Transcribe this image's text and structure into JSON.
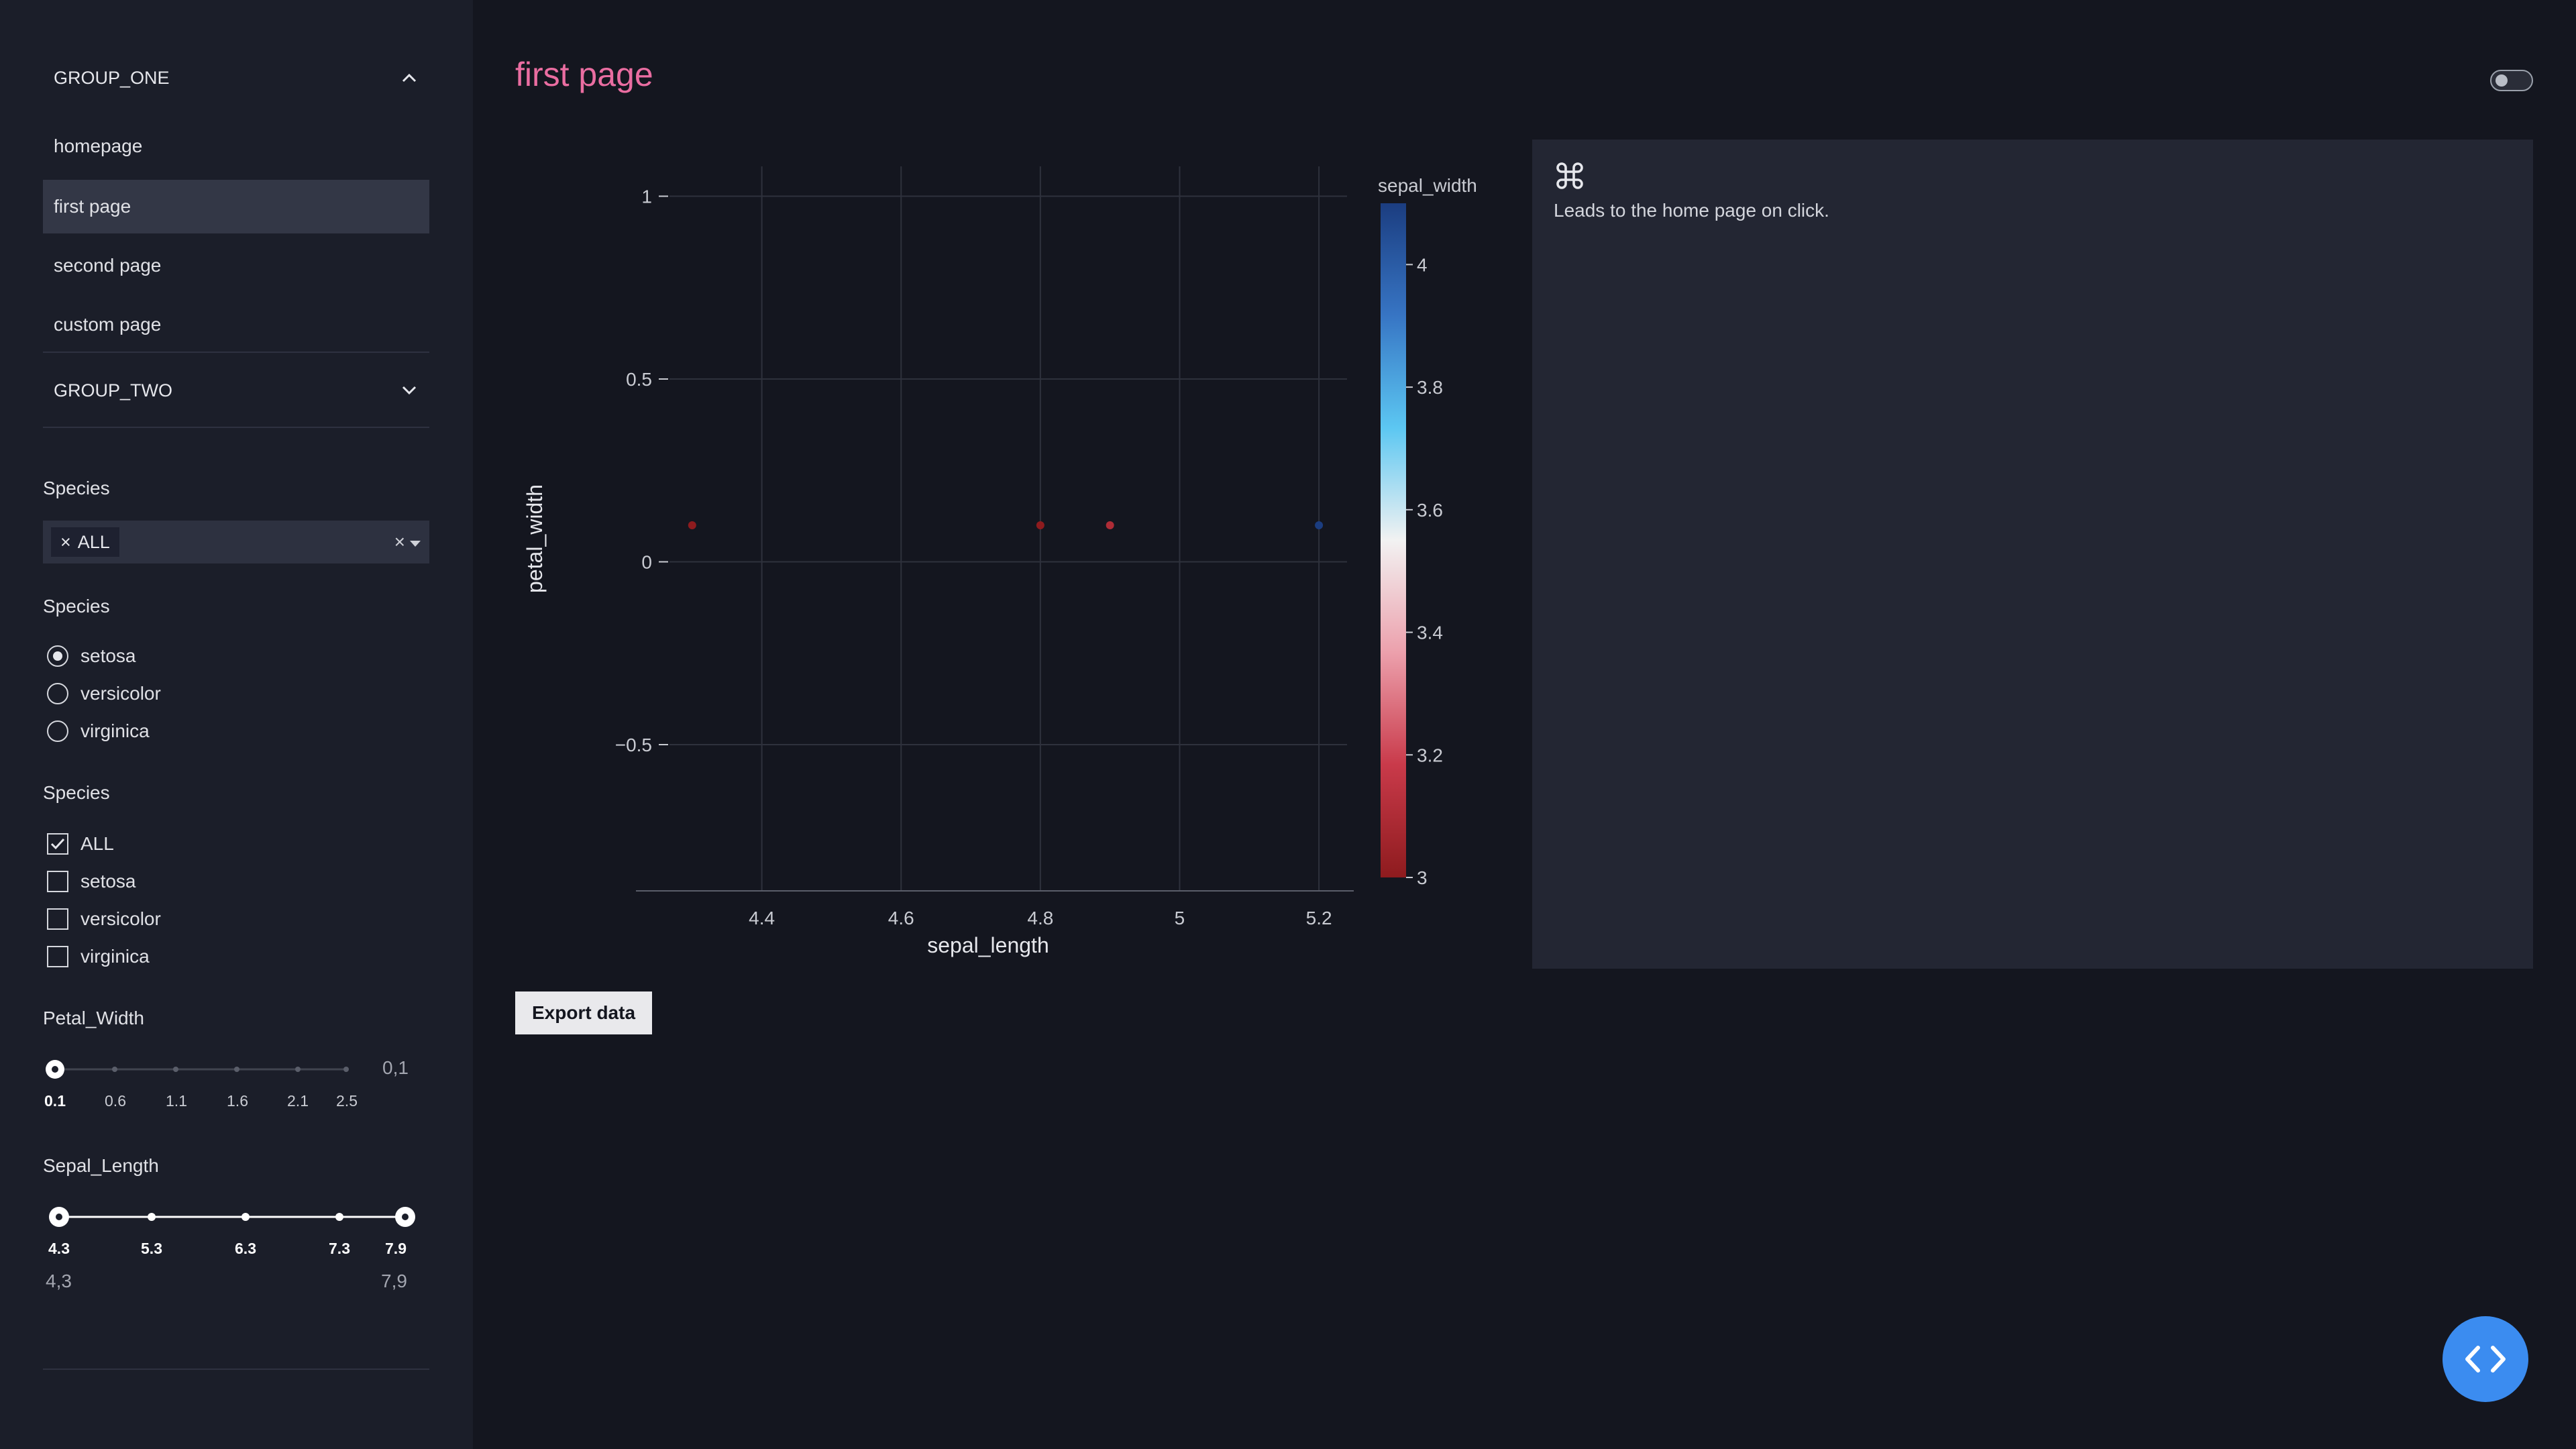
{
  "sidebar": {
    "group_one": {
      "label": "GROUP_ONE"
    },
    "nav_items": [
      {
        "label": "homepage"
      },
      {
        "label": "first page"
      },
      {
        "label": "second page"
      },
      {
        "label": "custom page"
      }
    ],
    "group_two": {
      "label": "GROUP_TWO"
    },
    "filters": {
      "dropdown": {
        "label": "Species",
        "selected": "ALL",
        "chip_remove": "×",
        "clear": "×"
      },
      "radio": {
        "label": "Species",
        "options": [
          "setosa",
          "versicolor",
          "virginica"
        ],
        "selected": "setosa"
      },
      "checklist": {
        "label": "Species",
        "options": [
          {
            "label": "ALL",
            "checked": true
          },
          {
            "label": "setosa",
            "checked": false
          },
          {
            "label": "versicolor",
            "checked": false
          },
          {
            "label": "virginica",
            "checked": false
          }
        ]
      },
      "petal_width": {
        "label": "Petal_Width",
        "marks": [
          "0.1",
          "0.6",
          "1.1",
          "1.6",
          "2.1",
          "2.5"
        ],
        "value_text": "0,1"
      },
      "sepal_length": {
        "label": "Sepal_Length",
        "marks": [
          "4.3",
          "5.3",
          "6.3",
          "7.3",
          "7.9"
        ],
        "min_text": "4,3",
        "max_text": "7,9"
      }
    }
  },
  "main": {
    "title": "first page",
    "export_label": "Export data",
    "card": {
      "text": "Leads to the home page on click."
    }
  },
  "colors": {
    "title": "#ea6da1",
    "accent": "#3b8cf0",
    "background": "#14161f",
    "sidebar": "#1b1e29",
    "card": "#232633"
  },
  "icons": {
    "theme": "toggle-switch-icon",
    "card": "command-icon",
    "fab": "code-brackets-icon"
  },
  "chart_data": {
    "type": "scatter",
    "title": "",
    "xlabel": "sepal_length",
    "ylabel": "petal_width",
    "xlim": [
      4.2,
      5.25
    ],
    "ylim": [
      -0.9,
      1.1
    ],
    "x_ticks": [
      4.4,
      4.6,
      4.8,
      5,
      5.2
    ],
    "x_tick_labels": [
      "4.4",
      "4.6",
      "4.8",
      "5",
      "5.2"
    ],
    "y_ticks": [
      -0.5,
      0,
      0.5,
      1
    ],
    "y_tick_labels": [
      "−0.5",
      "0",
      "0.5",
      "1"
    ],
    "grid": true,
    "points": [
      {
        "x": 4.3,
        "y": 0.1,
        "color_value": 3.0
      },
      {
        "x": 4.8,
        "y": 0.1,
        "color_value": 3.0
      },
      {
        "x": 4.9,
        "y": 0.1,
        "color_value": 3.1
      },
      {
        "x": 5.2,
        "y": 0.1,
        "color_value": 4.1
      }
    ],
    "colorbar": {
      "title": "sepal_width",
      "range": [
        3.0,
        4.1
      ],
      "ticks": [
        3,
        3.2,
        3.4,
        3.6,
        3.8,
        4
      ],
      "tick_labels": [
        "3",
        "3.2",
        "3.4",
        "3.6",
        "3.8",
        "4"
      ],
      "colorscale": [
        "#8e1b1e",
        "#c93a4a",
        "#eca0ac",
        "#f2f2f2",
        "#5cc7f2",
        "#3775c4",
        "#1b3d80"
      ]
    }
  }
}
